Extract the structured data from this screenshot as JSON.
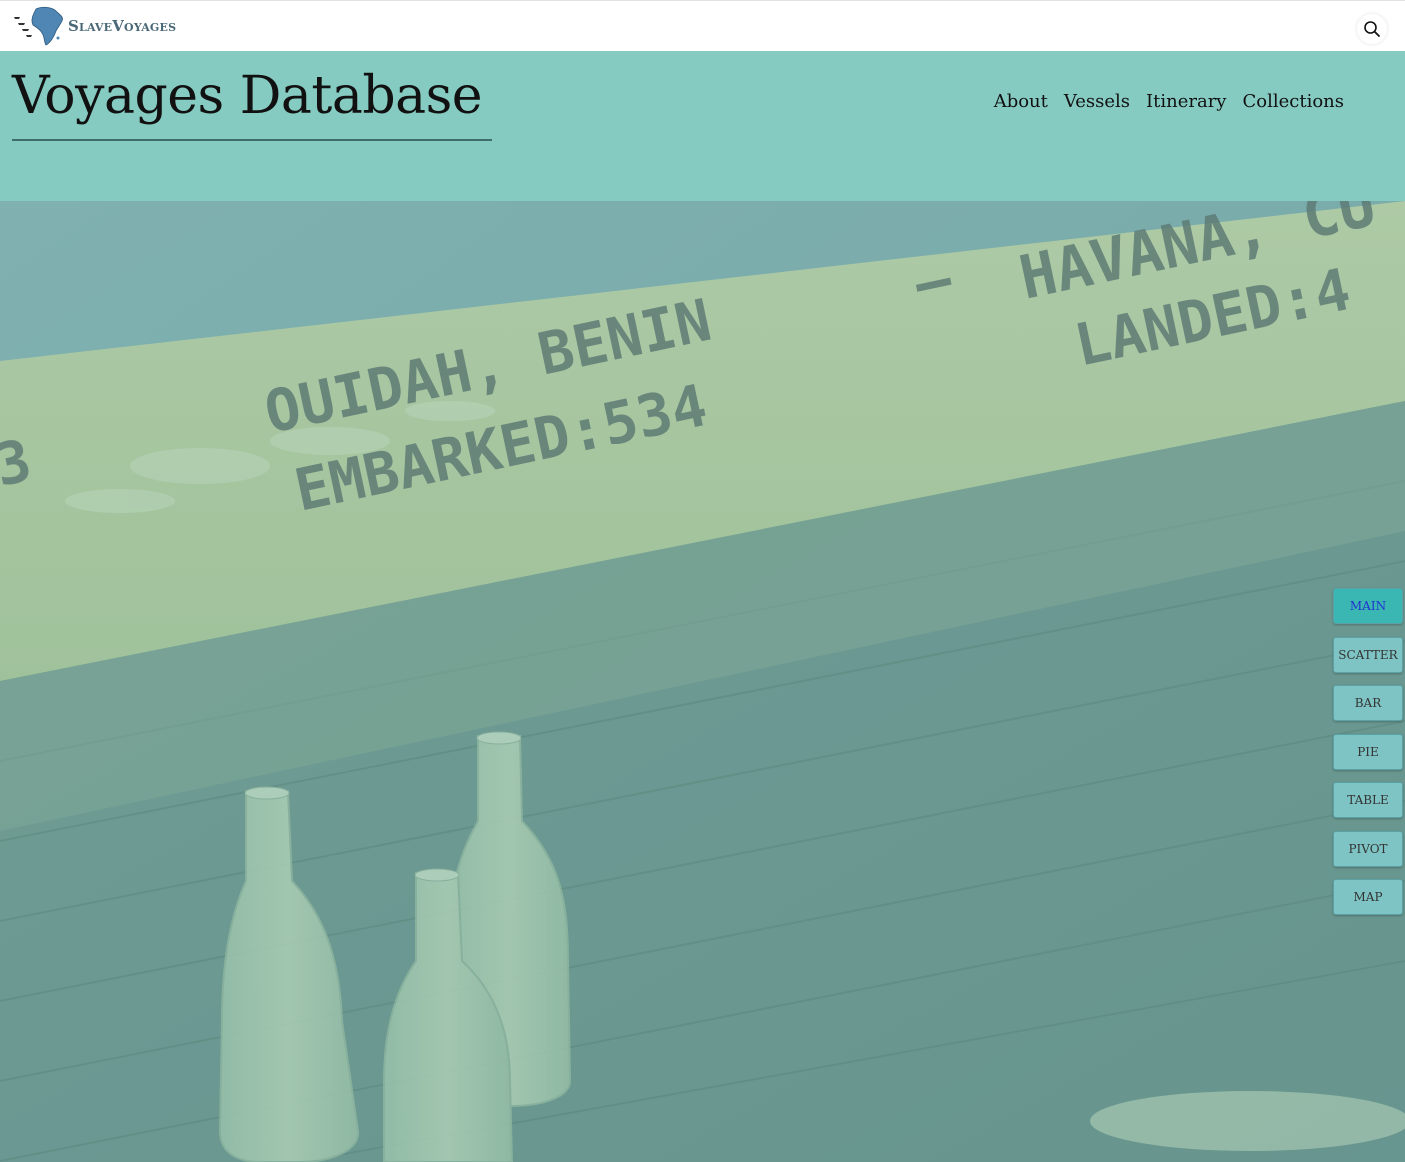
{
  "brand": {
    "name": "SlaveVoyages"
  },
  "header": {
    "title": "Voyages Database",
    "nav": [
      "About",
      "Vessels",
      "Itinerary",
      "Collections"
    ]
  },
  "hero": {
    "plank_text": {
      "line1_left": "OUIDAH, BENIN",
      "dash": "–",
      "line1_right": "HAVANA, CU",
      "line2_left": "EMBARKED:534",
      "line2_right": "LANDED:4",
      "edge": "3"
    }
  },
  "views": {
    "active": "MAIN",
    "buttons": [
      "MAIN",
      "SCATTER",
      "BAR",
      "PIE",
      "TABLE",
      "PIVOT",
      "MAP"
    ]
  },
  "colors": {
    "header_bg": "#86cbc2",
    "button_bg": "#7fc4c4",
    "button_active_bg": "#3ab7b3",
    "button_active_text": "#2033d0"
  }
}
